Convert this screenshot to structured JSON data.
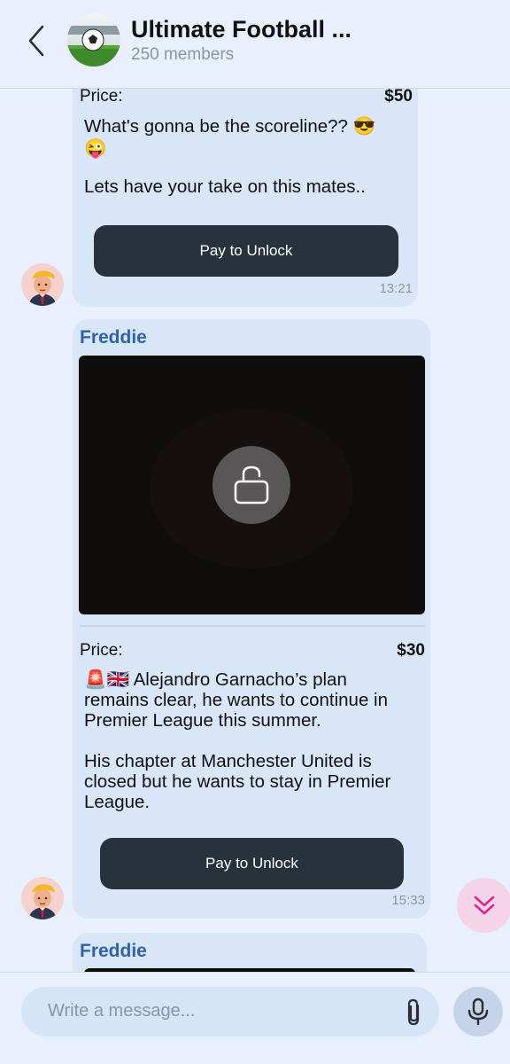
{
  "header": {
    "title": "Ultimate Football ...",
    "subtitle": "250 members"
  },
  "messages": [
    {
      "price_label": "Price:",
      "price": "$50",
      "text_line1": "What's gonna be the scoreline?? 😎",
      "text_line2": "😜",
      "text_line3": "Lets have your take on this mates..",
      "button": "Pay to Unlock",
      "time": "13:21"
    },
    {
      "sender": "Freddie",
      "price_label": "Price:",
      "price": "$30",
      "text_p1_l1": "🚨🇬🇧 Alejandro Garnacho’s plan",
      "text_p1_l2": "remains clear, he wants to continue in",
      "text_p1_l3": "Premier League this summer.",
      "text_p2_l1": "His chapter at Manchester United is",
      "text_p2_l2": "closed but he wants to stay in Premier",
      "text_p2_l3": "League.",
      "button": "Pay to Unlock",
      "time": "15:33"
    },
    {
      "sender": "Freddie"
    }
  ],
  "composer": {
    "placeholder": "Write a message..."
  },
  "icons": {
    "back": "chevron-left-icon",
    "lock": "lock-open-icon",
    "scroll": "double-chevron-down-icon",
    "attach": "paperclip-icon",
    "mic": "microphone-icon"
  },
  "colors": {
    "accent": "#2f62ad",
    "button": "#28323d",
    "bubble": "#d9e6f7",
    "background": "#e7f0fc",
    "scroll_button": "#f5d4e8",
    "scroll_icon": "#d9278f"
  }
}
